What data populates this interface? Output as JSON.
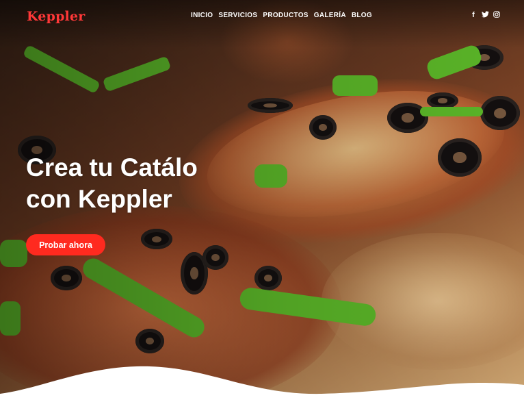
{
  "brand": {
    "logo_text": "Keppler",
    "accent": "#ff3838",
    "button_color": "#ff2a1f"
  },
  "nav": {
    "items": [
      {
        "label": "INICIO"
      },
      {
        "label": "SERVICIOS"
      },
      {
        "label": "PRODUCTOS"
      },
      {
        "label": "GALERÍA"
      },
      {
        "label": "BLOG"
      }
    ]
  },
  "social": [
    {
      "icon": "facebook-icon",
      "glyph": "f"
    },
    {
      "icon": "twitter-icon",
      "glyph": "🐦"
    },
    {
      "icon": "instagram-icon",
      "glyph": "◎"
    }
  ],
  "hero": {
    "title_line1": "Crea tu Catálo",
    "title_line2": "con Keppler",
    "cta_label": "Probar ahora",
    "background_icon": "pizza-photo"
  }
}
